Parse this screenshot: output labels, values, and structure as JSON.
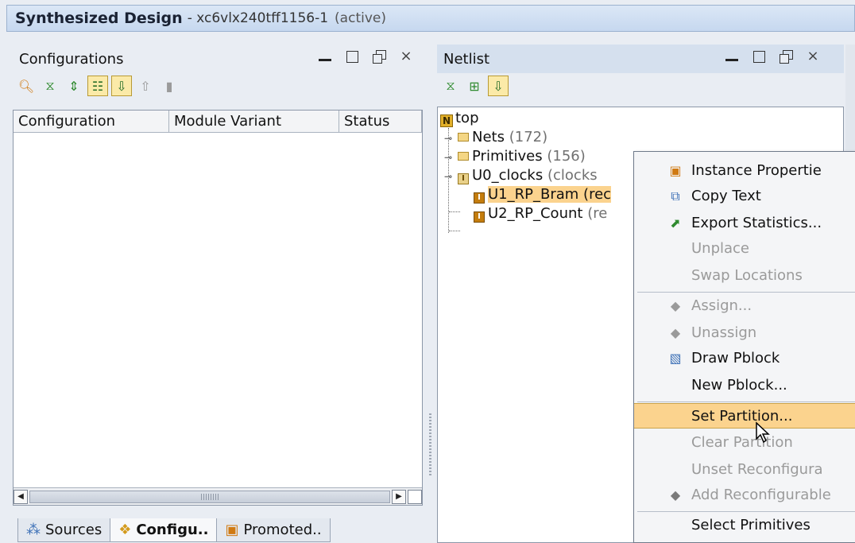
{
  "window": {
    "title": "Synthesized Design",
    "device": "- xc6vlx240tff1156-1",
    "state": "(active)"
  },
  "configurations": {
    "title": "Configurations",
    "columns": [
      "Configuration",
      "Module Variant",
      "Status"
    ],
    "rows": []
  },
  "bottom_tabs": [
    {
      "label": "Sources",
      "icon": "sources-icon",
      "active": false
    },
    {
      "label": "Configu..",
      "icon": "configurations-icon",
      "active": true
    },
    {
      "label": "Promoted..",
      "icon": "promoted-icon",
      "active": false
    }
  ],
  "netlist": {
    "title": "Netlist",
    "tree": {
      "root": "top",
      "children": [
        {
          "name": "Nets",
          "count": "(172)",
          "type": "folder"
        },
        {
          "name": "Primitives",
          "count": "(156)",
          "type": "folder"
        },
        {
          "name": "U0_clocks",
          "count": "(clocks",
          "type": "instance"
        },
        {
          "name": "U1_RP_Bram",
          "count": "(rec",
          "type": "instance",
          "selected": true
        },
        {
          "name": "U2_RP_Count",
          "count": "(re",
          "type": "instance"
        }
      ]
    }
  },
  "context_menu": {
    "items": [
      {
        "label": "Instance Propertie",
        "icon": "properties-icon",
        "enabled": true
      },
      {
        "label": "Copy Text",
        "icon": "copy-icon",
        "enabled": true
      },
      {
        "label": "Export Statistics...",
        "icon": "export-icon",
        "enabled": true
      },
      {
        "label": "Unplace",
        "enabled": false
      },
      {
        "label": "Swap Locations",
        "enabled": false
      },
      {
        "label": "Assign...",
        "icon": "assign-icon",
        "enabled": false
      },
      {
        "label": "Unassign",
        "icon": "unassign-icon",
        "enabled": false
      },
      {
        "label": "Draw Pblock",
        "icon": "draw-pblock-icon",
        "enabled": true
      },
      {
        "label": "New Pblock...",
        "enabled": true
      },
      {
        "label": "Set Partition...",
        "enabled": true,
        "highlighted": true
      },
      {
        "label": "Clear Partition",
        "enabled": false
      },
      {
        "label": "Unset Reconfigura",
        "enabled": false
      },
      {
        "label": "Add Reconfigurable",
        "icon": "add-reconfigurable-icon",
        "enabled": false
      },
      {
        "label": "Select Primitives",
        "enabled": true
      }
    ]
  },
  "colors": {
    "selection": "#fbd38e",
    "toggle_on": "#fbeaa8",
    "disabled_text": "#9a9a9a"
  }
}
